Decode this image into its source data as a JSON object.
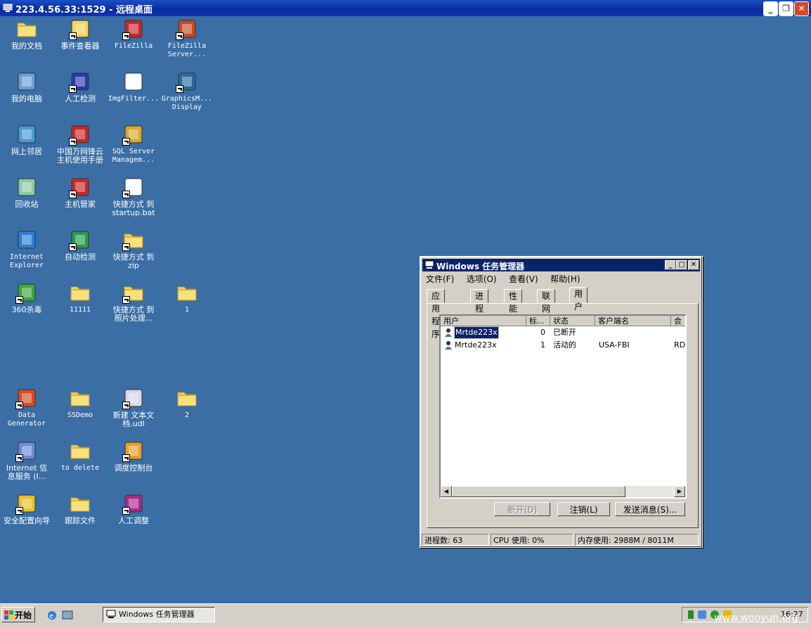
{
  "rdp": {
    "title": "223.4.56.33:1529 - 远程桌面",
    "buttons": [
      "_",
      "❐",
      "✕"
    ]
  },
  "desktop": {
    "icons": [
      {
        "label": "我的文档",
        "icon": "my-documents-icon"
      },
      {
        "label": "事件查看器",
        "icon": "event-viewer-icon"
      },
      {
        "label": "FileZilla",
        "icon": "filezilla-icon"
      },
      {
        "label": "FileZilla\nServer...",
        "icon": "filezilla-server-icon"
      },
      {
        "label": "我的电脑",
        "icon": "my-computer-icon"
      },
      {
        "label": "人工检测",
        "icon": "user-id-icon"
      },
      {
        "label": "ImgFilter...",
        "icon": "doc-icon"
      },
      {
        "label": "GraphicsM...\nDisplay",
        "icon": "graphics-icon"
      },
      {
        "label": "网上邻居",
        "icon": "network-icon"
      },
      {
        "label": "中国万网锋云\n主机使用手册",
        "icon": "cloud-manual-icon"
      },
      {
        "label": "SQL Server\nManagem...",
        "icon": "sql-server-icon"
      },
      {
        "label": "回收站",
        "icon": "recycle-bin-icon"
      },
      {
        "label": "主机管家",
        "icon": "host-manager-icon"
      },
      {
        "label": "快捷方式 到\nstartup.bat",
        "icon": "batch-icon"
      },
      {
        "label": "Internet\nExplorer",
        "icon": "ie-icon"
      },
      {
        "label": "自动检测",
        "icon": "auto-detect-icon"
      },
      {
        "label": "快捷方式 到\nzip",
        "icon": "folder-icon"
      },
      {
        "label": "360杀毒",
        "icon": "antivirus-icon"
      },
      {
        "label": "11111",
        "icon": "folder-icon"
      },
      {
        "label": "快捷方式 到\n照片处理...",
        "icon": "folder-icon"
      },
      {
        "label": "1",
        "icon": "folder-icon"
      },
      {
        "label": "Data\nGenerator",
        "icon": "data-generator-icon"
      },
      {
        "label": "SSDemo",
        "icon": "folder-icon"
      },
      {
        "label": "新建 文本文\n档.udl",
        "icon": "udl-icon"
      },
      {
        "label": "2",
        "icon": "folder-icon"
      },
      {
        "label": "Internet 信\n息服务 (I...",
        "icon": "iis-icon"
      },
      {
        "label": "to delete",
        "icon": "folder-icon"
      },
      {
        "label": "调度控制台",
        "icon": "console-icon"
      },
      {
        "label": "安全配置向导",
        "icon": "security-wizard-icon"
      },
      {
        "label": "跟踪文件",
        "icon": "folder-icon"
      },
      {
        "label": "人工调整",
        "icon": "user-adjust-icon"
      }
    ]
  },
  "taskmgr": {
    "title": "Windows 任务管理器",
    "menu": [
      "文件(F)",
      "选项(O)",
      "查看(V)",
      "帮助(H)"
    ],
    "tabs": [
      "应用程序",
      "进程",
      "性能",
      "联网",
      "用户"
    ],
    "columns": [
      "用户",
      "标...",
      "状态",
      "客户端名",
      "会"
    ],
    "rows": [
      {
        "user": "Mrtde223x",
        "id": "0",
        "status": "已断开",
        "client": "",
        "session": ""
      },
      {
        "user": "Mrtde223x",
        "id": "1",
        "status": "活动的",
        "client": "USA-FBI",
        "session": "RDI"
      }
    ],
    "buttons": {
      "disconnect": "断开(D)",
      "logoff": "注销(L)",
      "send": "发送消息(S)..."
    },
    "status": {
      "processes": "进程数: 63",
      "cpu": "CPU 使用: 0%",
      "mem": "内存使用: 2988M / 8011M"
    }
  },
  "taskbar": {
    "start": "开始",
    "task": "Windows 任务管理器",
    "clock": "16:27"
  },
  "watermark": "www.wooyun.org"
}
